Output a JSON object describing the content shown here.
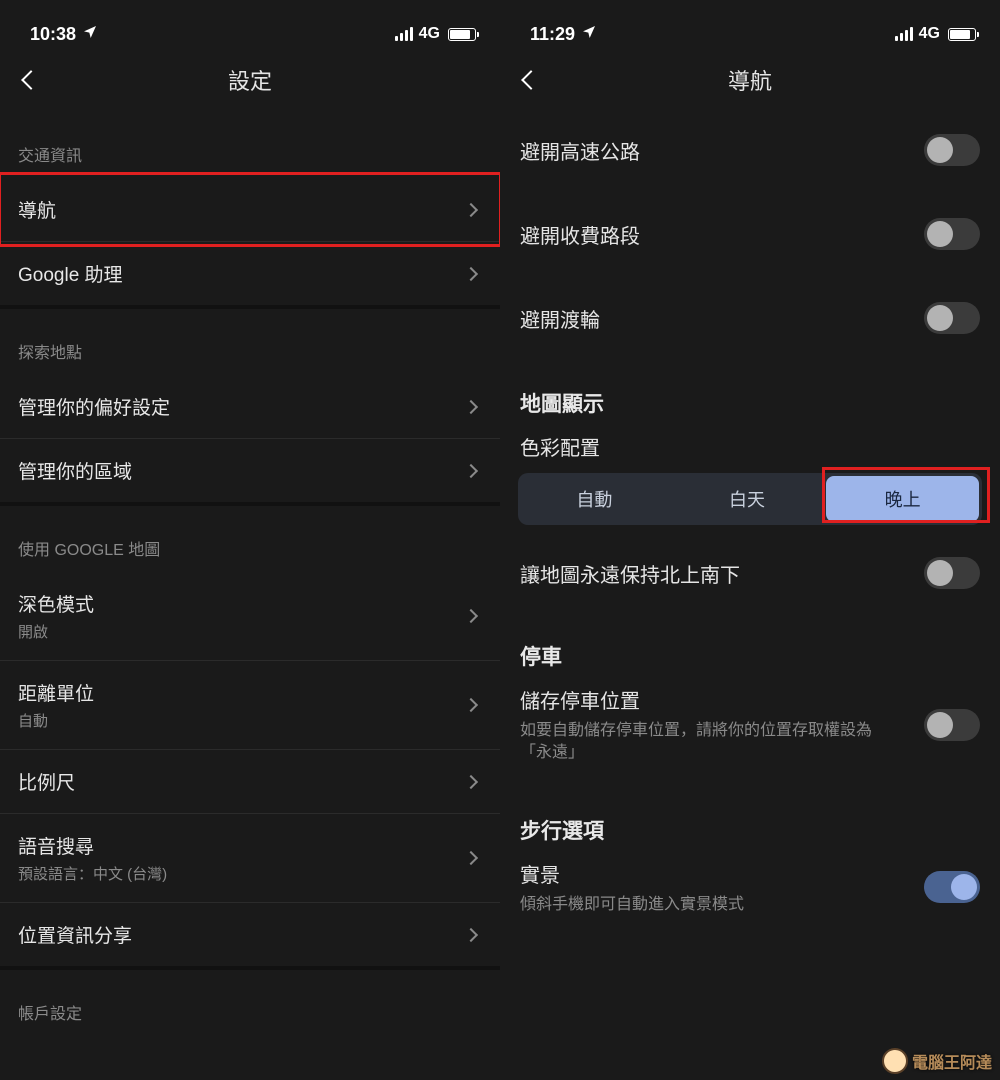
{
  "left": {
    "status": {
      "time": "10:38",
      "network": "4G"
    },
    "title": "設定",
    "sections": [
      {
        "header": "交通資訊",
        "rows": [
          {
            "label": "導航"
          },
          {
            "label": "Google 助理"
          }
        ]
      },
      {
        "header": "探索地點",
        "rows": [
          {
            "label": "管理你的偏好設定"
          },
          {
            "label": "管理你的區域"
          }
        ]
      },
      {
        "header": "使用 GOOGLE 地圖",
        "rows": [
          {
            "label": "深色模式",
            "sub": "開啟"
          },
          {
            "label": "距離單位",
            "sub": "自動"
          },
          {
            "label": "比例尺"
          },
          {
            "label": "語音搜尋",
            "sub": "預設語言：中文 (台灣)"
          },
          {
            "label": "位置資訊分享"
          }
        ]
      }
    ],
    "bottom_hint": "帳戶設定"
  },
  "right": {
    "status": {
      "time": "11:29",
      "network": "4G"
    },
    "title": "導航",
    "avoid": {
      "highway": "避開高速公路",
      "toll": "避開收費路段",
      "ferry": "避開渡輪"
    },
    "map_display": {
      "title": "地圖顯示",
      "color_scheme_label": "色彩配置",
      "options": {
        "auto": "自動",
        "day": "白天",
        "night": "晚上"
      },
      "keep_north": "讓地圖永遠保持北上南下"
    },
    "parking": {
      "title": "停車",
      "save_title": "儲存停車位置",
      "save_desc": "如要自動儲存停車位置，請將你的位置存取權設為「永遠」"
    },
    "walking": {
      "title": "步行選項",
      "live_title": "實景",
      "live_desc": "傾斜手機即可自動進入實景模式"
    }
  },
  "watermark": "電腦王阿達"
}
